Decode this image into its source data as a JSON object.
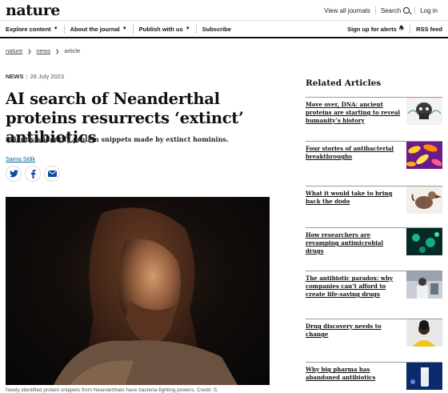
{
  "header": {
    "logo": "nature",
    "links": [
      "View all journals",
      "Search",
      "Log in"
    ]
  },
  "nav": {
    "left": [
      "Explore content",
      "About the journal",
      "Publish with us",
      "Subscribe"
    ],
    "right": [
      "Sign up for alerts",
      "RSS feed"
    ]
  },
  "breadcrumb": [
    "nature",
    "news",
    "article"
  ],
  "article": {
    "type": "NEWS",
    "date": "28 July 2023",
    "title": "AI search of Neanderthal proteins resurrects ‘extinct’ antibiotics",
    "standfirst": "Scientists identify protein snippets made by extinct hominins.",
    "author": "Saima Sidik",
    "caption": "Newly identified protein snippets from Neanderthals have bacteria-fighting powers. Credit: S."
  },
  "share_icons": [
    "twitter-icon",
    "facebook-icon",
    "email-icon"
  ],
  "related": {
    "heading": "Related Articles",
    "items": [
      "Move over, DNA: ancient proteins are starting to reveal humanity’s history",
      "Four stories of antibacterial breakthroughs",
      "What it would take to bring back the dodo",
      "How researchers are revamping antimicrobial drugs",
      "The antibiotic paradox: why companies can’t afford to create life-saving drugs",
      "Drug discovery needs to change",
      "Why big pharma has abandoned antibiotics"
    ]
  },
  "colors": {
    "link": "#006699",
    "share_icon": "#0e4b9c",
    "rule": "#111111"
  }
}
